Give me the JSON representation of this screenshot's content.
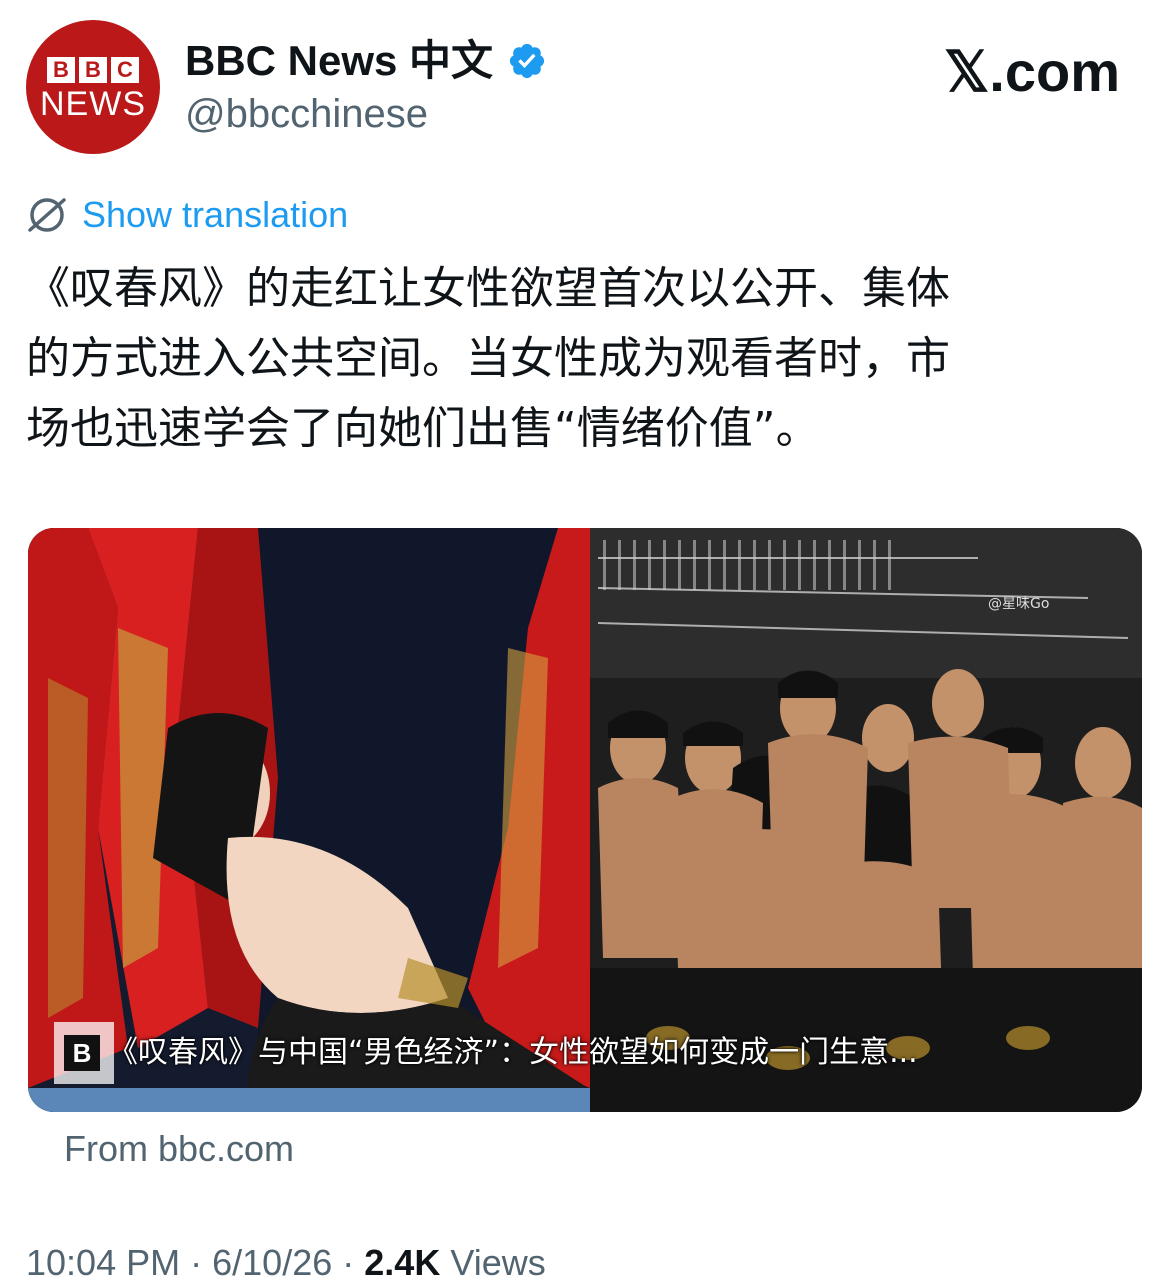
{
  "header": {
    "avatar": {
      "logo_letters": [
        "B",
        "B",
        "C"
      ],
      "logo_word": "NEWS",
      "background_color": "#bb1919"
    },
    "display_name": "BBC News 中文",
    "verified_icon": "verified-badge-icon",
    "verified_color": "#1d9bf0",
    "handle": "@bbcchinese",
    "site_mark": "𝕏.com"
  },
  "translation": {
    "icon": "globe-icon",
    "label": "Show translation",
    "color": "#1d9bf0"
  },
  "tweet": {
    "lines": [
      "《叹春风》的走红让女性欲望首次以公开、集体",
      "的方式进入公共空间。当女性成为观看者时，市",
      "场也迅速学会了向她们出售“情绪价值”。"
    ]
  },
  "media": {
    "watermark": "@星味Go",
    "caption_badge": "B",
    "caption": "《叹春风》与中国“男色经济”：女性欲望如何变成一门生意..."
  },
  "link_source": "From bbc.com",
  "meta": {
    "time": "10:04 PM",
    "separator": "·",
    "date": "6/10/26",
    "views_count": "2.4K",
    "views_label": "Views"
  }
}
